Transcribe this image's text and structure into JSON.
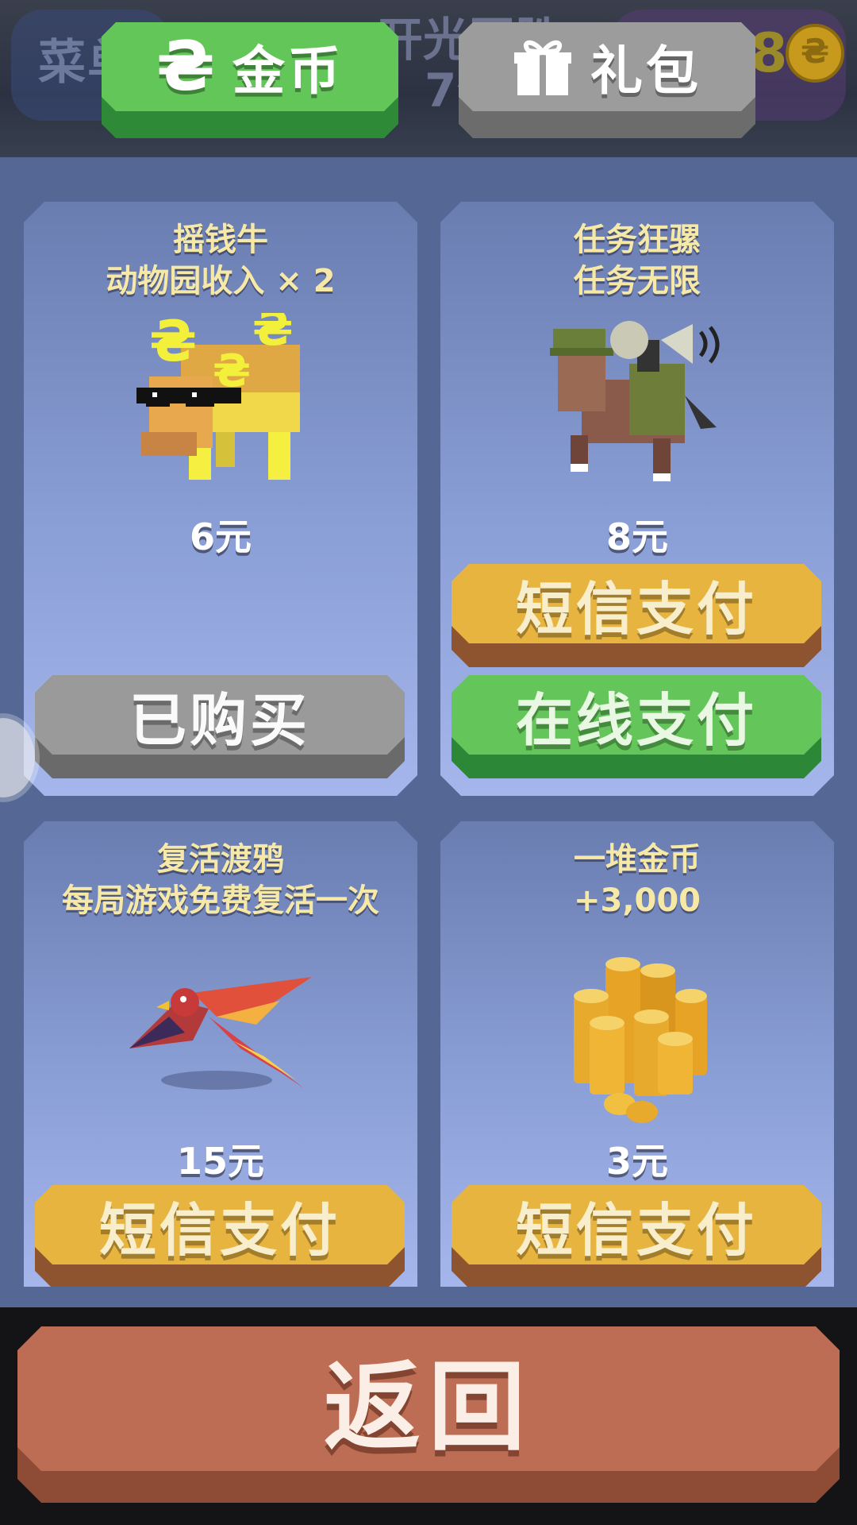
{
  "background": {
    "left_text": "菜单",
    "mid_text_line1": "开光团胜",
    "mid_text_line2": "7分",
    "right_number": "8",
    "right_coin_glyph": "₴"
  },
  "tabs": [
    {
      "label": "金币",
      "icon": "coin-icon",
      "active": true
    },
    {
      "label": "礼包",
      "icon": "gift-icon",
      "active": false
    }
  ],
  "coin_glyph": "₴",
  "items": [
    {
      "title_line1": "摇钱牛",
      "title_line2": "动物园收入 × 2",
      "icon": "money-cow-icon",
      "price": "6元",
      "buttons": [
        {
          "type": "bought",
          "label": "已购买"
        }
      ]
    },
    {
      "title_line1": "任务狂骡",
      "title_line2": "任务无限",
      "icon": "mission-mule-icon",
      "price": "8元",
      "buttons": [
        {
          "type": "sms",
          "label": "短信支付"
        },
        {
          "type": "online",
          "label": "在线支付"
        }
      ]
    },
    {
      "title_line1": "复活渡鸦",
      "title_line2": "每局游戏免费复活一次",
      "icon": "revive-raven-icon",
      "price": "15元",
      "buttons": [
        {
          "type": "sms",
          "label": "短信支付"
        }
      ]
    },
    {
      "title_line1": "一堆金币",
      "title_line2": "+3,000",
      "icon": "coin-pile-icon",
      "price": "3元",
      "buttons": [
        {
          "type": "sms",
          "label": "短信支付"
        }
      ]
    }
  ],
  "back_button": {
    "label": "返回"
  },
  "colors": {
    "panel": "#556895",
    "tab_active": "#63c658",
    "tab_inactive": "#9c9c9c",
    "sms_button": "#e7b43f",
    "online_button": "#64c65a",
    "bought_button": "#9a9a9a",
    "back_button": "#bd6d53"
  }
}
